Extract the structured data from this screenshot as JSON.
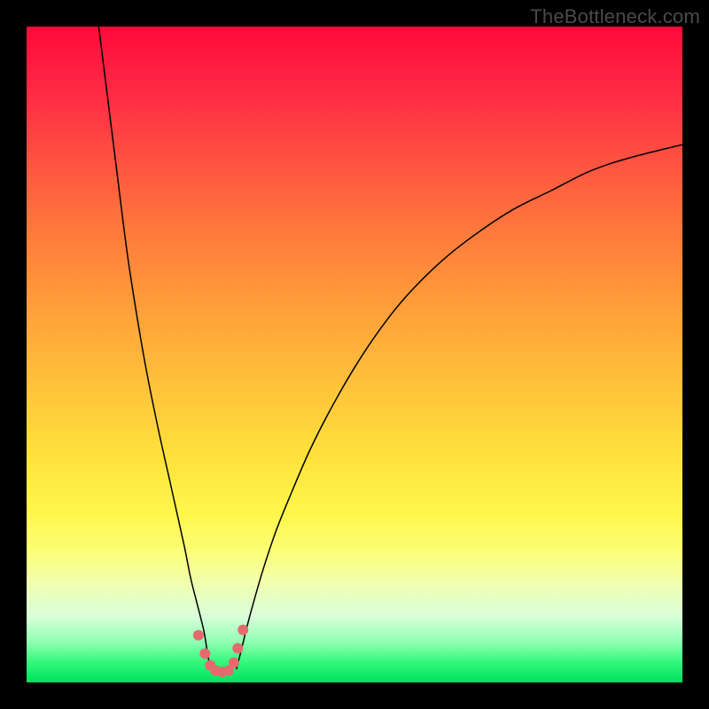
{
  "watermark": "TheBottleneck.com",
  "chart_data": {
    "type": "line",
    "title": "",
    "xlabel": "",
    "ylabel": "",
    "xlim": [
      0,
      100
    ],
    "ylim": [
      0,
      100
    ],
    "curve_style": {
      "stroke": "#000000",
      "stroke_width": 1.5
    },
    "series": [
      {
        "name": "left-branch",
        "x": [
          11,
          12,
          13,
          14,
          15,
          16,
          18,
          20,
          22,
          24,
          25,
          26,
          27,
          27.5,
          28
        ],
        "y": [
          100,
          92,
          84,
          76,
          68,
          61,
          49,
          39,
          30,
          21,
          16,
          12,
          8,
          5,
          2
        ]
      },
      {
        "name": "right-branch",
        "x": [
          32,
          33,
          34,
          36,
          38,
          40,
          43,
          46,
          50,
          54,
          58,
          63,
          68,
          74,
          80,
          86,
          92,
          100
        ],
        "y": [
          2,
          6,
          10,
          17,
          23,
          28,
          35,
          41,
          48,
          54,
          59,
          64,
          68,
          72,
          75,
          78,
          80,
          82
        ]
      }
    ],
    "marker_points": {
      "x": [
        26.2,
        27.2,
        28.0,
        28.8,
        29.8,
        30.8,
        31.6,
        32.2,
        33.0
      ],
      "y": [
        7.2,
        4.4,
        2.6,
        1.8,
        1.6,
        1.8,
        3.0,
        5.2,
        8.0
      ],
      "color": "#e46b6d",
      "radius": 6
    }
  },
  "gradient_colors": {
    "top": "#ff0a3a",
    "mid": "#ffe03c",
    "bottom": "#00e060"
  }
}
